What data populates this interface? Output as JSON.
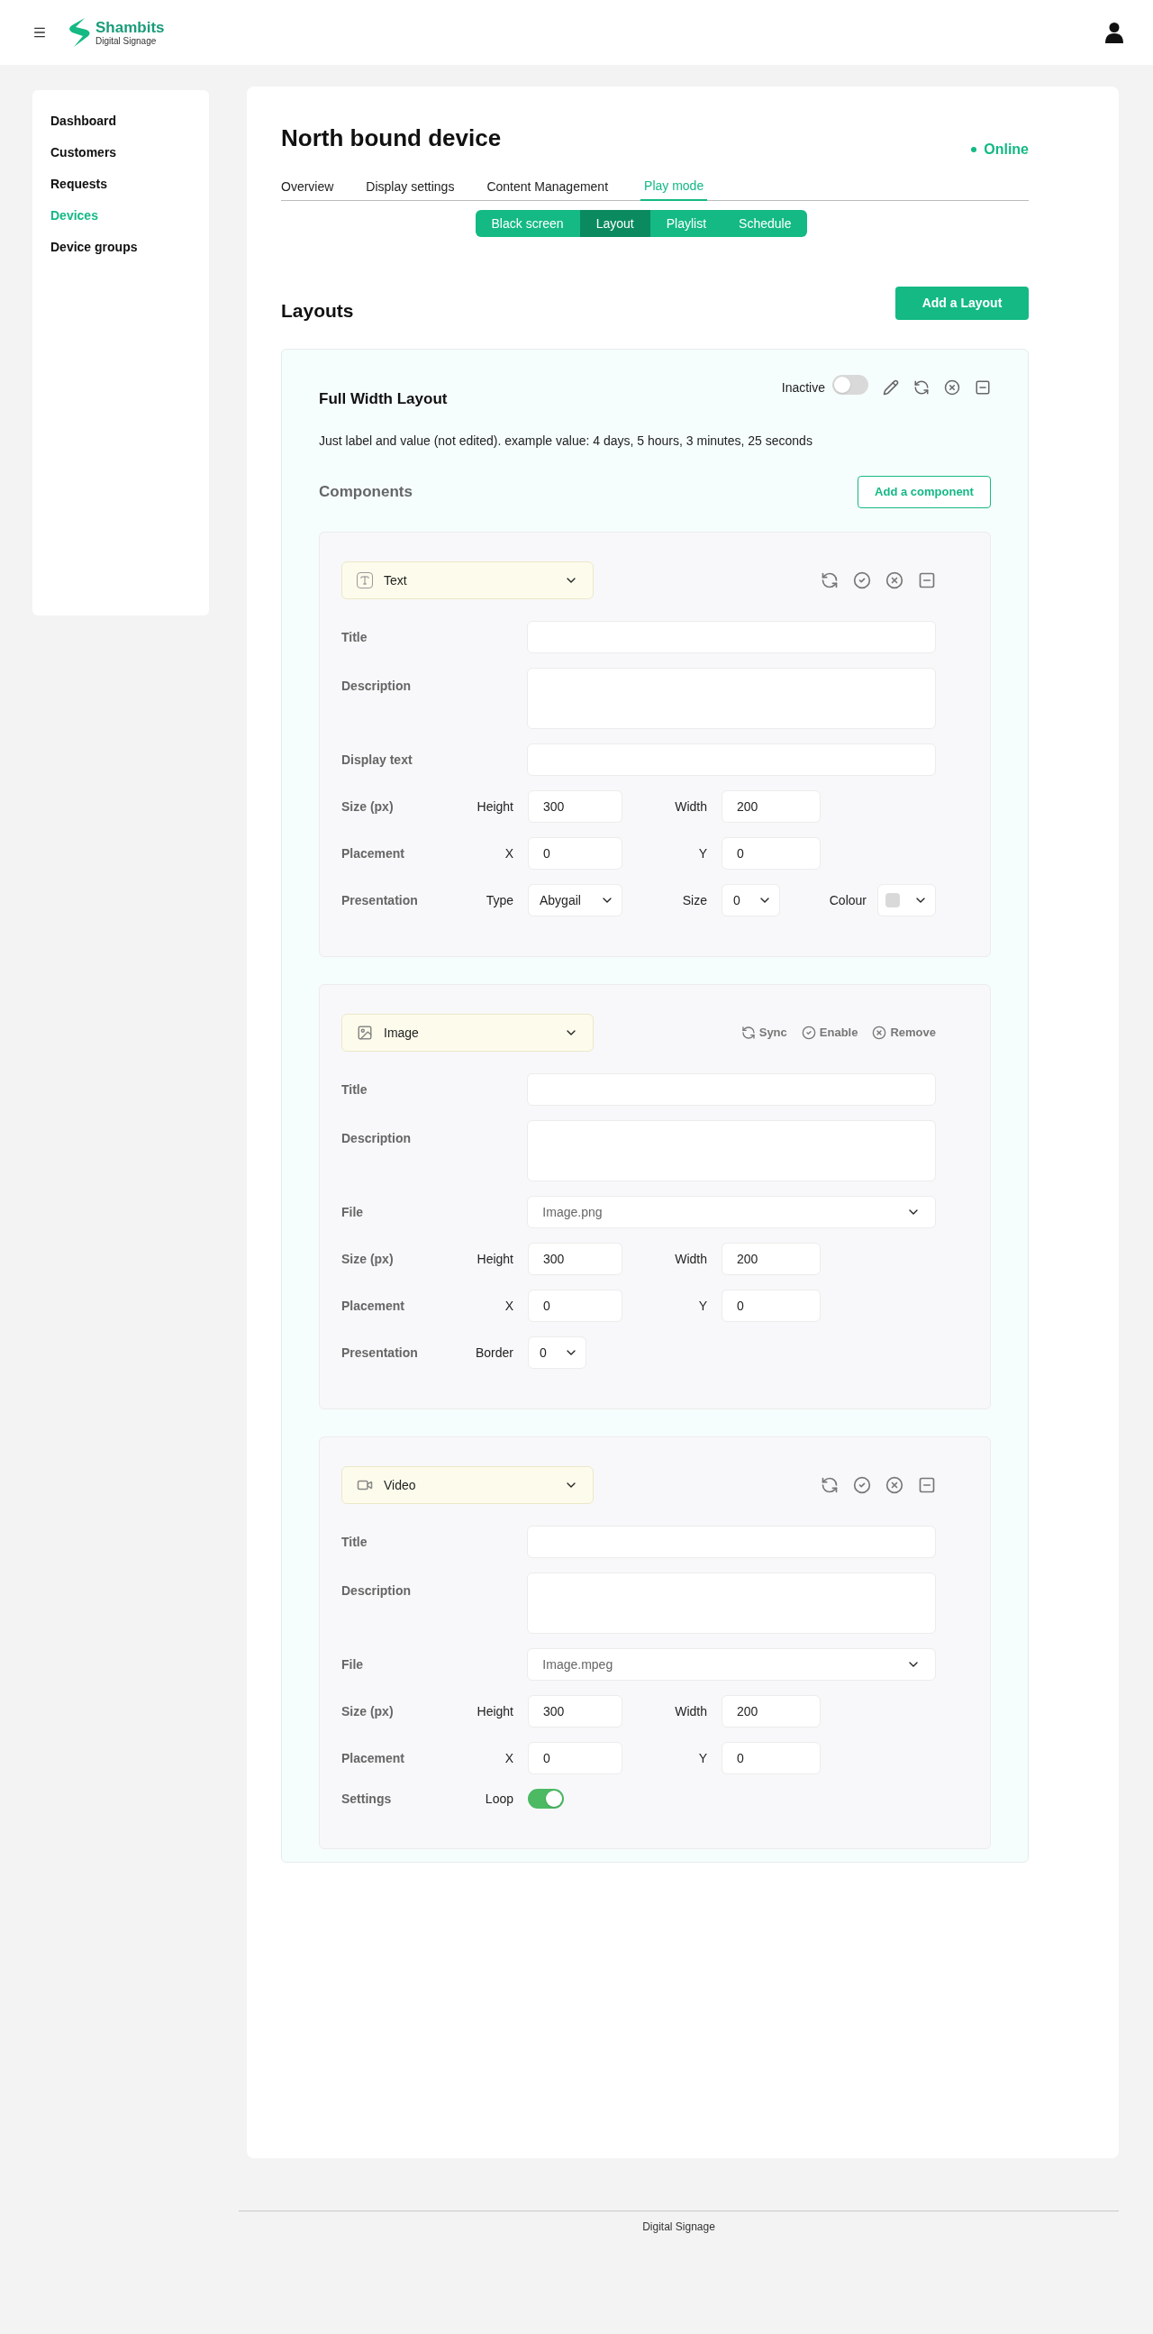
{
  "header": {
    "brand": {
      "name": "Shambits",
      "tagline": "Digital Signage"
    }
  },
  "sidebar": {
    "items": [
      {
        "label": "Dashboard",
        "selected": false
      },
      {
        "label": "Customers",
        "selected": false
      },
      {
        "label": "Requests",
        "selected": false
      },
      {
        "label": "Devices",
        "selected": true
      },
      {
        "label": "Device groups",
        "selected": false
      }
    ]
  },
  "device": {
    "title": "North bound device",
    "status": "Online",
    "online": true
  },
  "tabs": [
    {
      "label": "Overview",
      "selected": false
    },
    {
      "label": "Display settings",
      "selected": false
    },
    {
      "label": "Content Management",
      "selected": false
    },
    {
      "label": "Play mode",
      "selected": true
    }
  ],
  "modes": [
    {
      "label": "Black screen",
      "selected": false
    },
    {
      "label": "Layout",
      "selected": true
    },
    {
      "label": "Playlist",
      "selected": false
    },
    {
      "label": "Schedule",
      "selected": false
    }
  ],
  "layouts": {
    "heading": "Layouts",
    "add_button": "Add a Layout",
    "layout": {
      "title": "Full Width Layout",
      "toggle_label": "Inactive",
      "on": false,
      "description": "Just label and value (not edited). example value: 4 days, 5 hours, 3 minutes, 25 seconds",
      "components_heading": "Components",
      "add_component_button": "Add a component",
      "components": [
        {
          "kind": "text",
          "label": "Text",
          "actions": [
            {
              "kind": "sync"
            },
            {
              "kind": "enable"
            },
            {
              "kind": "remove"
            },
            {
              "kind": "collapse"
            }
          ],
          "rows": [
            {
              "kind": "input",
              "label": "Title"
            },
            {
              "kind": "textarea",
              "label": "Description"
            },
            {
              "kind": "input",
              "label": "Display text"
            },
            {
              "kind": "pair",
              "label": "Size (px)",
              "fields": [
                {
                  "label": "Height",
                  "value": "300"
                },
                {
                  "label": "Width",
                  "value": "200"
                }
              ]
            },
            {
              "kind": "pair",
              "label": "Placement",
              "fields": [
                {
                  "label": "X",
                  "value": "0"
                },
                {
                  "label": "Y",
                  "value": "0"
                }
              ]
            },
            {
              "kind": "controls",
              "label": "Presentation",
              "controls": [
                {
                  "kind": "select",
                  "label": "Type",
                  "value": "Abygail"
                },
                {
                  "kind": "select",
                  "label": "Size",
                  "value": "0"
                },
                {
                  "kind": "colour",
                  "label": "Colour",
                  "color": "#d9d9d9"
                }
              ]
            }
          ]
        },
        {
          "kind": "image",
          "label": "Image",
          "actions": [
            {
              "kind": "sync",
              "label": "Sync"
            },
            {
              "kind": "enable",
              "label": "Enable"
            },
            {
              "kind": "remove",
              "label": "Remove"
            }
          ],
          "rows": [
            {
              "kind": "input",
              "label": "Title"
            },
            {
              "kind": "textarea",
              "label": "Description"
            },
            {
              "kind": "file",
              "label": "File",
              "value": "Image.png"
            },
            {
              "kind": "pair",
              "label": "Size (px)",
              "fields": [
                {
                  "label": "Height",
                  "value": "300"
                },
                {
                  "label": "Width",
                  "value": "200"
                }
              ]
            },
            {
              "kind": "pair",
              "label": "Placement",
              "fields": [
                {
                  "label": "X",
                  "value": "0"
                },
                {
                  "label": "Y",
                  "value": "0"
                }
              ]
            },
            {
              "kind": "controls",
              "label": "Presentation",
              "controls": [
                {
                  "kind": "select",
                  "label": "Border",
                  "value": "0"
                }
              ]
            }
          ]
        },
        {
          "kind": "video",
          "label": "Video",
          "actions": [
            {
              "kind": "sync"
            },
            {
              "kind": "enable"
            },
            {
              "kind": "remove"
            },
            {
              "kind": "collapse"
            }
          ],
          "rows": [
            {
              "kind": "input",
              "label": "Title"
            },
            {
              "kind": "textarea",
              "label": "Description"
            },
            {
              "kind": "file",
              "label": "File",
              "value": "Image.mpeg"
            },
            {
              "kind": "pair",
              "label": "Size (px)",
              "fields": [
                {
                  "label": "Height",
                  "value": "300"
                },
                {
                  "label": "Width",
                  "value": "200"
                }
              ]
            },
            {
              "kind": "pair",
              "label": "Placement",
              "fields": [
                {
                  "label": "X",
                  "value": "0"
                },
                {
                  "label": "Y",
                  "value": "0"
                }
              ]
            },
            {
              "kind": "controls",
              "label": "Settings",
              "controls": [
                {
                  "kind": "toggle",
                  "label": "Loop",
                  "on": true
                }
              ]
            }
          ]
        }
      ]
    }
  },
  "footer": {
    "text": "Digital Signage"
  }
}
